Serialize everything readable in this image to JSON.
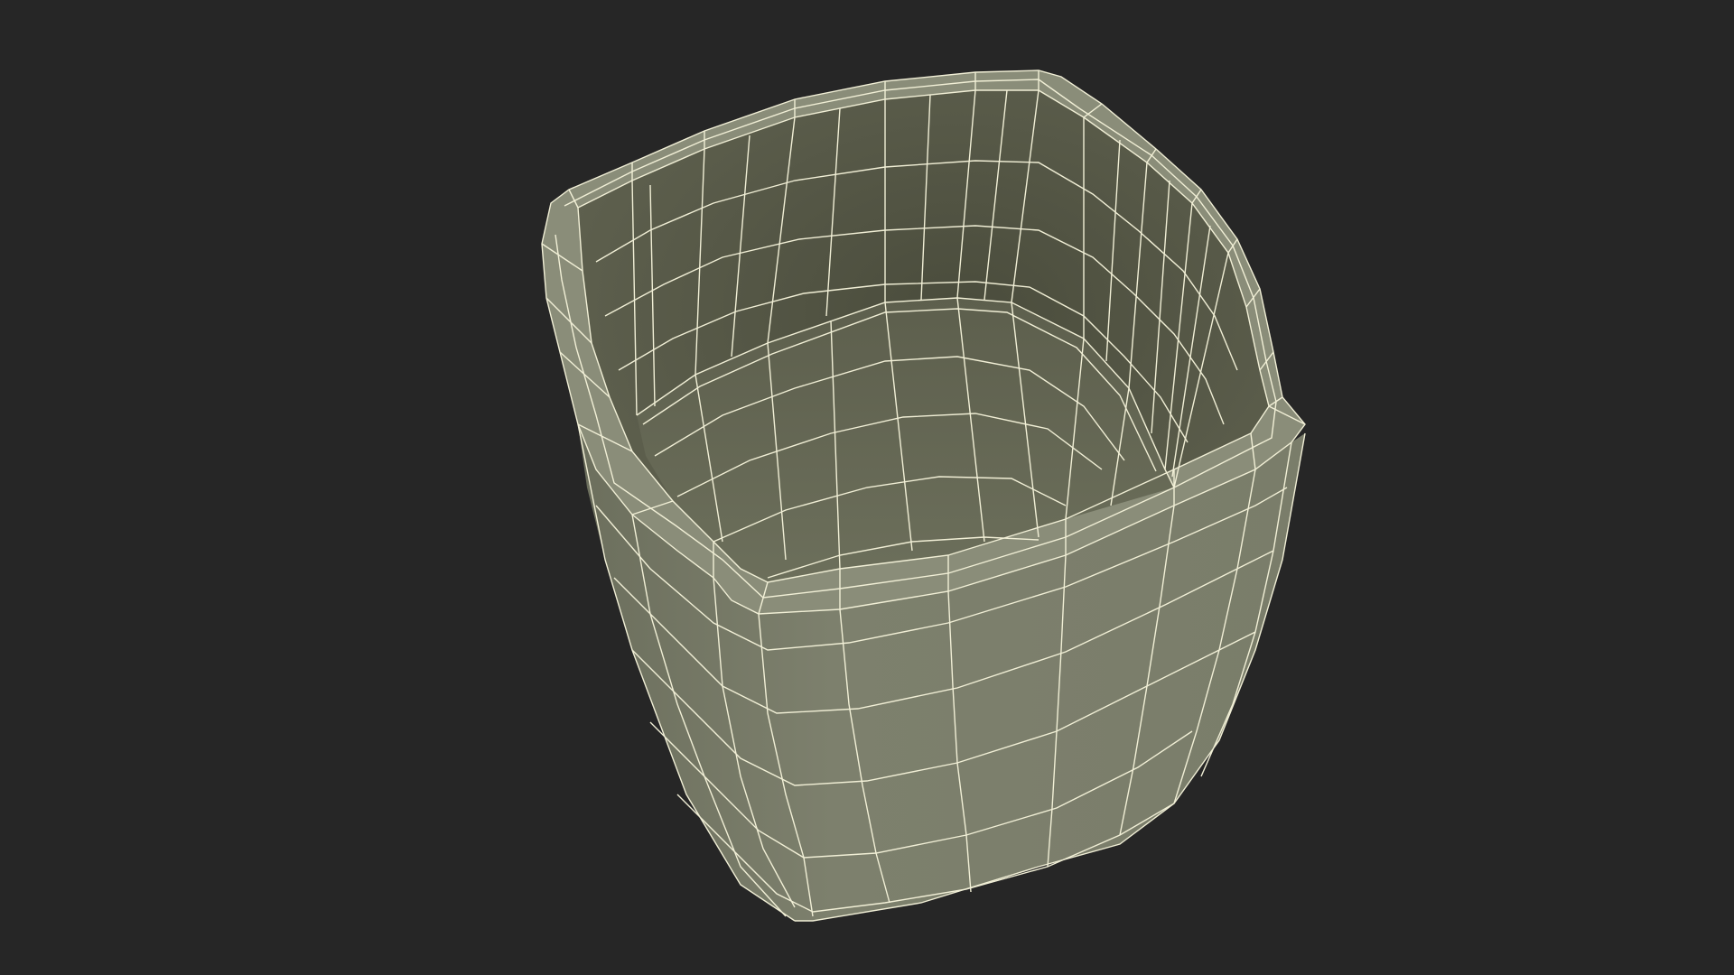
{
  "scene": {
    "background_color": "#262626",
    "model_name": "wireframe-cup",
    "render_style": "wireframe-on-shaded",
    "colors": {
      "outer_wall": "#7c7f6c",
      "outer_wall_shadow": "#6b6e5c",
      "inner_wall": "#5b5d4b",
      "inner_wall_dark": "#4a4c3c",
      "inner_floor": "#676a57",
      "rim": "#8a8d79",
      "wire": "#f1efd6"
    }
  }
}
